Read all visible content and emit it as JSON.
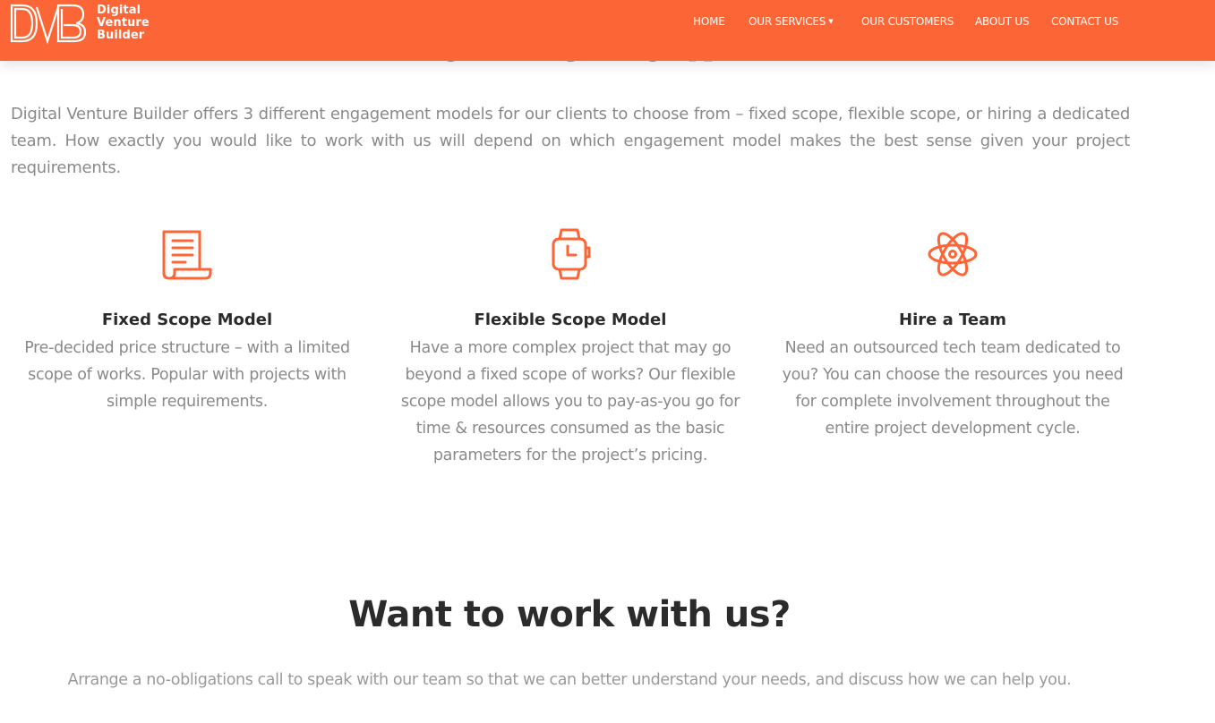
{
  "brand": {
    "logo_text": [
      "Digital",
      "Venture",
      "Builder"
    ],
    "accent_color": "#fc6535"
  },
  "nav": {
    "items": [
      "HOME",
      "OUR SERVICES",
      "OUR CUSTOMERS",
      "ABOUT US",
      "CONTACT US"
    ]
  },
  "how": {
    "heading": "How We Work?",
    "intro": "Digital Venture Builder offers 3 different engagement models for our clients to choose from – fixed scope, flexible scope, or hiring a dedicated team. How exactly you would like to work with us will depend on which engagement model makes the best sense given your project requirements."
  },
  "models": [
    {
      "icon": "document-scroll-icon",
      "title": "Fixed Scope Model",
      "text": "Pre-decided price structure – with a limited scope of works. Popular with projects with simple requirements."
    },
    {
      "icon": "smartwatch-icon",
      "title": "Flexible Scope Model",
      "text": "Have a more complex project that may go beyond a fixed scope of works? Our flexible scope model allows you to pay-as-you go for time & resources consumed as the basic parameters for the project’s pricing."
    },
    {
      "icon": "atom-icon",
      "title": "Hire a Team",
      "text": "Need an outsourced tech team dedicated to you? You can choose the resources you need for complete involvement throughout the entire project development cycle."
    }
  ],
  "cta": {
    "title": "Want to work with us?",
    "text": "Arrange a no-obligations call to speak with our team so that we can better understand your needs, and discuss how we can help you."
  }
}
